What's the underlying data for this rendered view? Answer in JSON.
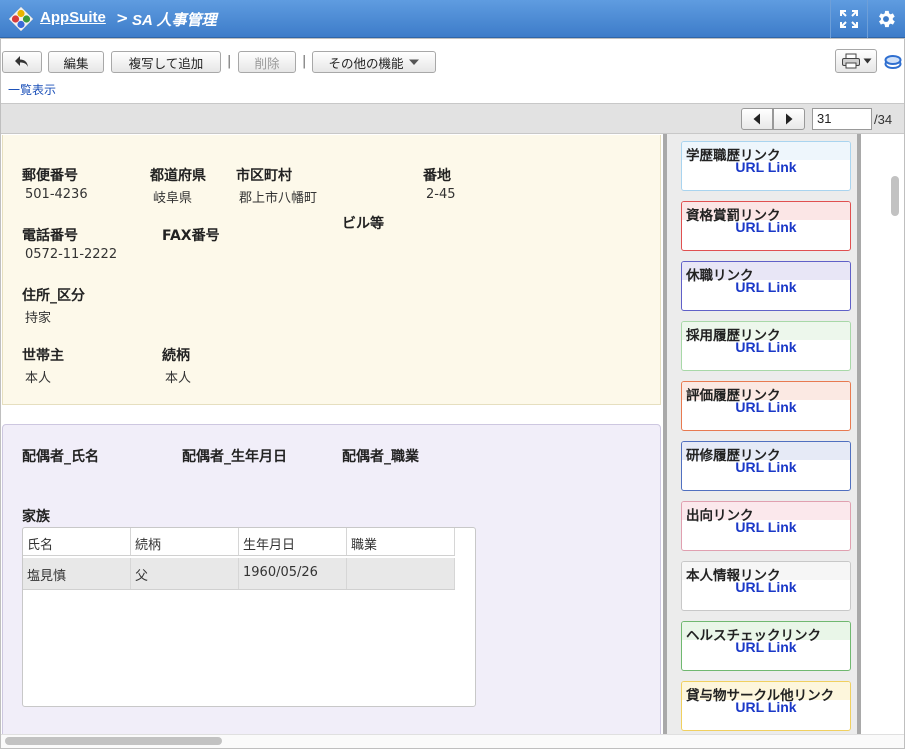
{
  "header": {
    "app_name": "AppSuite",
    "separator": ">",
    "module_name": "SA 人事管理"
  },
  "toolbar": {
    "edit_label": "編集",
    "copy_add_label": "複写して追加",
    "delete_label": "削除",
    "more_label": "その他の機能",
    "sep": "|",
    "list_view_link": "一覧表示"
  },
  "pager": {
    "current": "31",
    "total": "/34"
  },
  "address": {
    "postal_label": "郵便番号",
    "postal_value": "501-4236",
    "prefecture_label": "都道府県",
    "prefecture_value": "岐阜県",
    "city_label": "市区町村",
    "city_value": "郡上市八幡町",
    "street_label": "番地",
    "street_value": "2-45",
    "building_label": "ビル等",
    "phone_label": "電話番号",
    "phone_value": "0572-11-2222",
    "fax_label": "FAX番号",
    "residence_label": "住所_区分",
    "residence_value": "持家",
    "householder_label": "世帯主",
    "householder_value": "本人",
    "relation_label": "続柄",
    "relation_value": "本人"
  },
  "spouse": {
    "name_label": "配偶者_氏名",
    "birth_label": "配偶者_生年月日",
    "job_label": "配偶者_職業",
    "family_label": "家族"
  },
  "family_table": {
    "headers": [
      "氏名",
      "続柄",
      "生年月日",
      "職業"
    ],
    "rows": [
      [
        "塩見慎",
        "父",
        "1960/05/26",
        ""
      ]
    ]
  },
  "links": [
    {
      "title": "学歴職歴リンク",
      "link": "URL Link",
      "color": "#a9d4ef",
      "head_bg": "#eef6fc"
    },
    {
      "title": "資格賞罰リンク",
      "link": "URL Link",
      "color": "#e05050",
      "head_bg": "#fbe6e6"
    },
    {
      "title": "休職リンク",
      "link": "URL Link",
      "color": "#6060c8",
      "head_bg": "#e8e6f6"
    },
    {
      "title": "採用履歴リンク",
      "link": "URL Link",
      "color": "#a8d8a8",
      "head_bg": "#edf7ec"
    },
    {
      "title": "評価履歴リンク",
      "link": "URL Link",
      "color": "#e87a50",
      "head_bg": "#fbe9e3"
    },
    {
      "title": "研修履歴リンク",
      "link": "URL Link",
      "color": "#5070c0",
      "head_bg": "#e6eaf6"
    },
    {
      "title": "出向リンク",
      "link": "URL Link",
      "color": "#e0a0b0",
      "head_bg": "#fbe8ec"
    },
    {
      "title": "本人情報リンク",
      "link": "URL Link",
      "color": "#c8c8c8",
      "head_bg": "#f6f6f6"
    },
    {
      "title": "ヘルスチェックリンク",
      "link": "URL Link",
      "color": "#70b870",
      "head_bg": "#e9f6e8"
    },
    {
      "title": "貸与物サークル他リンク",
      "link": "URL Link",
      "color": "#f0d060",
      "head_bg": "#fdf6dc"
    }
  ]
}
